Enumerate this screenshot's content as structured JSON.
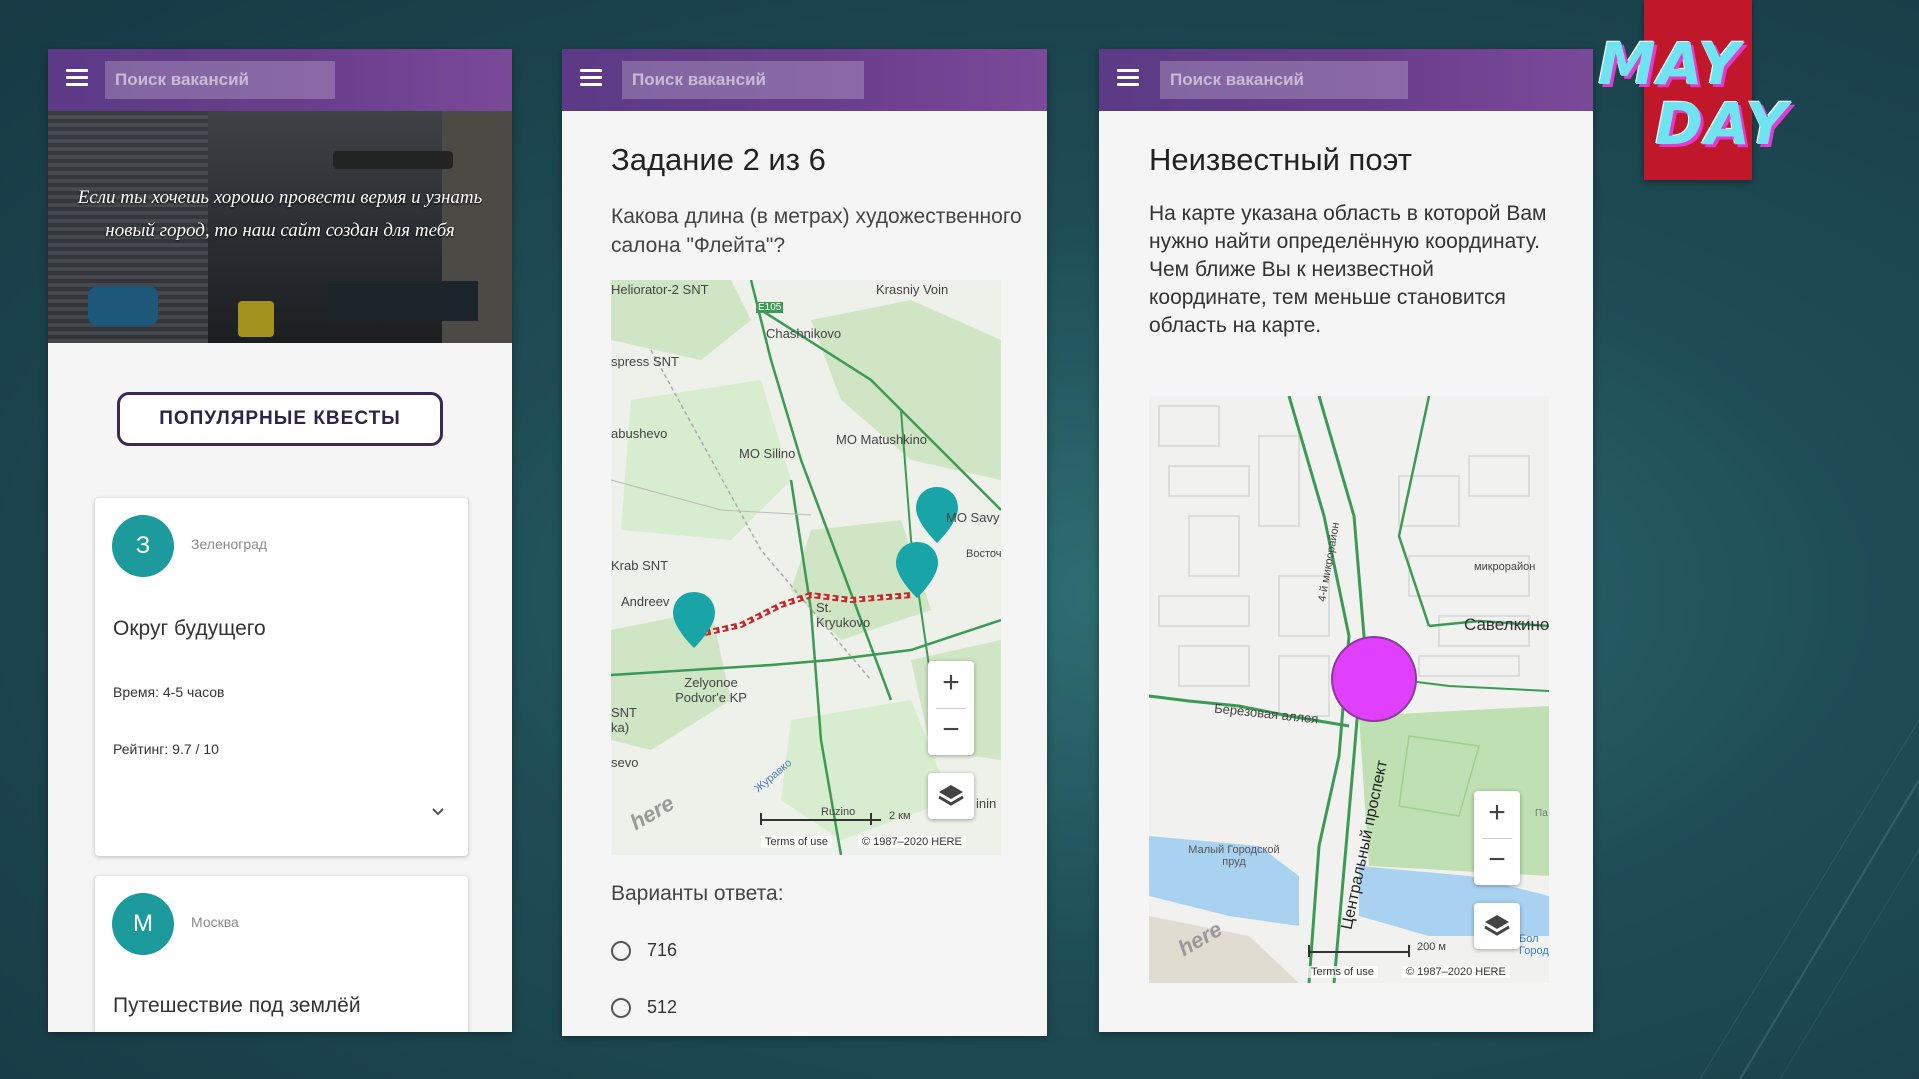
{
  "logo": {
    "line1": "MAY",
    "line2": "DAY",
    "box_color": "#c0182a"
  },
  "appbar": {
    "search_placeholder": "Поиск вакансий",
    "menu_icon": "hamburger-icon"
  },
  "panel1": {
    "hero_text": "Если ты хочешь хорошо провести вермя и узнать новый город, то наш сайт создан для тебя",
    "popular_button": "ПОПУЛЯРНЫЕ КВЕСТЫ",
    "cards": [
      {
        "avatar": "З",
        "city": "Зеленоград",
        "title": "Округ будущего",
        "time": "Время: 4-5 часов",
        "rating": "Рейтинг: 9.7 / 10"
      },
      {
        "avatar": "М",
        "city": "Москва",
        "title": "Путешествие под землёй"
      }
    ]
  },
  "panel2": {
    "heading": "Задание 2 из 6",
    "question": "Какова длина (в метрах) художественного салона \"Флейта\"?",
    "map": {
      "labels": [
        "Heliorator-2 SNT",
        "Krasniy Voin",
        "E105",
        "Chashnikovo",
        "spress SNT",
        "abushevo",
        "MO Silino",
        "MO Matushkino",
        "MO Savy",
        "Восточ",
        "Krab SNT",
        "Andreev",
        "St. Kryukovo",
        "Zelyonoe Podvor'e KP",
        "SNT ka)",
        "sevo",
        "Журавко",
        "Ruzino",
        "2 км",
        "inin"
      ],
      "zoom_in": "+",
      "zoom_out": "−",
      "terms": "Terms of use",
      "copyright": "© 1987–2020 HERE",
      "brand": "here"
    },
    "answers_heading": "Варианты ответа:",
    "answers": [
      "716",
      "512"
    ]
  },
  "panel3": {
    "heading": "Неизвестный поэт",
    "description": "На карте указана область в которой Вам нужно найти определённую координату. Чем ближе Вы к неизвестной координате, тем меньше становится область на карте.",
    "map": {
      "labels": [
        "4-й микрорайон",
        "микрорайон",
        "Савелкино",
        "Берёзовая аллея",
        "Центральный проспект",
        "Малый Городской пруд",
        "Па",
        "Бол Городс",
        "200 м"
      ],
      "zoom_in": "+",
      "zoom_out": "−",
      "terms": "Terms of use",
      "copyright": "© 1987–2020 HERE",
      "brand": "here",
      "area_color": "#e040fb"
    }
  }
}
